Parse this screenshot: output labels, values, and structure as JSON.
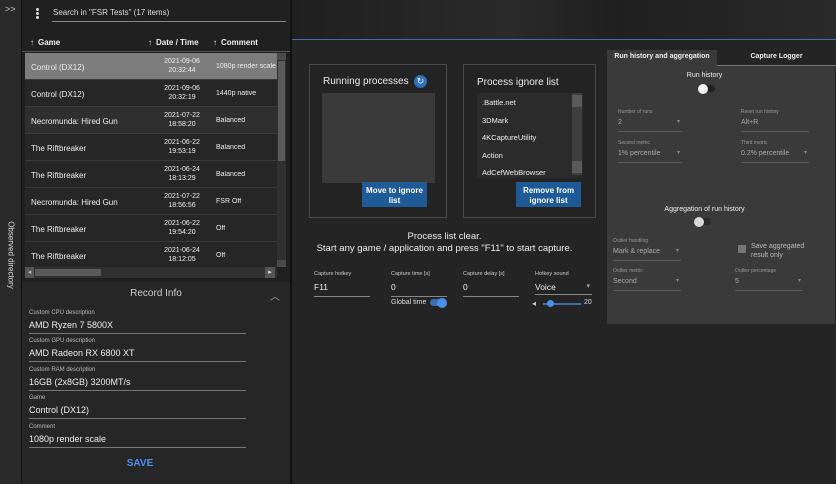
{
  "sidebar": {
    "collapse_label": ">>",
    "observed_directory_label": "Observed directory"
  },
  "left": {
    "search_text": "Search in \"FSR Tests\" (17 items)",
    "columns": {
      "game": "Game",
      "date": "Date / Time",
      "comment": "Comment",
      "sort_arrow": "↑"
    },
    "rows": [
      {
        "game": "Control (DX12)",
        "date": "2021-09-06",
        "time": "20:32:44",
        "comment": "1080p render scale",
        "selected": true
      },
      {
        "game": "Control (DX12)",
        "date": "2021-09-06",
        "time": "20:32:19",
        "comment": "1440p native"
      },
      {
        "game": "Necromunda: Hired Gun",
        "date": "2021-07-22",
        "time": "18:58:20",
        "comment": "Balanced"
      },
      {
        "game": "The Riftbreaker",
        "date": "2021-06-22",
        "time": "19:53:19",
        "comment": "Balanced"
      },
      {
        "game": "The Riftbreaker",
        "date": "2021-06-24",
        "time": "18:13:29",
        "comment": "Balanced"
      },
      {
        "game": "Necromunda: Hired Gun",
        "date": "2021-07-22",
        "time": "18:56:56",
        "comment": "FSR Off"
      },
      {
        "game": "The Riftbreaker",
        "date": "2021-06-22",
        "time": "19:54:20",
        "comment": "Off"
      },
      {
        "game": "The Riftbreaker",
        "date": "2021-06-24",
        "time": "18:12:05",
        "comment": "Off"
      }
    ],
    "record_info": {
      "title": "Record Info",
      "cpu_label": "Custom CPU description",
      "cpu_value": "AMD Ryzen 7 5800X",
      "gpu_label": "Custom GPU description",
      "gpu_value": "AMD Radeon RX 6800 XT",
      "ram_label": "Custom RAM description",
      "ram_value": "16GB (2x8GB) 3200MT/s",
      "game_label": "Game",
      "game_value": "Control (DX12)",
      "comment_label": "Comment",
      "comment_value": "1080p render scale",
      "save_label": "SAVE"
    }
  },
  "capture": {
    "running_title": "Running processes",
    "move_button": "Move to ignore list",
    "ignore_title": "Process ignore list",
    "ignore_items": [
      ".Battle.net",
      "3DMark",
      "4KCaptureUtility",
      "Action",
      "AdCefWebBrowser"
    ],
    "remove_button": "Remove from ignore list",
    "status_line1": "Process list clear.",
    "status_line2": "Start any game / application and press \"F11\" to start capture.",
    "hotkey_label": "Capture hotkey",
    "hotkey_value": "F11",
    "time_label": "Capture time [s]",
    "time_value": "0",
    "delay_label": "Capture delay [s]",
    "delay_value": "0",
    "sound_label": "Hotkey sound",
    "sound_value": "Voice",
    "global_time_label": "Global time",
    "global_time_on": true,
    "volume_value": "20",
    "volume_fraction": 0.2
  },
  "tabs": {
    "run_history_tab": "Run history and aggregation",
    "capture_logger_tab": "Capture Logger",
    "active": "run_history_tab"
  },
  "run_history": {
    "run_history_label": "Run history",
    "run_history_on": false,
    "num_runs_label": "Number of runs",
    "num_runs_value": "2",
    "reset_label": "Reset run history",
    "reset_value": "Alt+R",
    "second_metric_label": "Second metric",
    "second_metric_value": "1% percentile",
    "third_metric_label": "Third metric",
    "third_metric_value": "0.2% percentile",
    "aggregation_label": "Aggregation of run history",
    "aggregation_on": false,
    "outlier_handling_label": "Outlier handling",
    "outlier_handling_value": "Mark & replace",
    "save_aggregated_label": "Save aggregated result only",
    "save_aggregated_checked": true,
    "outlier_metric_label": "Outlier metric",
    "outlier_metric_value": "Second",
    "outlier_pct_label": "Outlier percentage",
    "outlier_pct_value": "5"
  },
  "colors": {
    "accent": "#2f6fbf",
    "button": "#1e5a95",
    "save_text": "#4f8ff0",
    "selected_row": "#7c7c7c"
  }
}
